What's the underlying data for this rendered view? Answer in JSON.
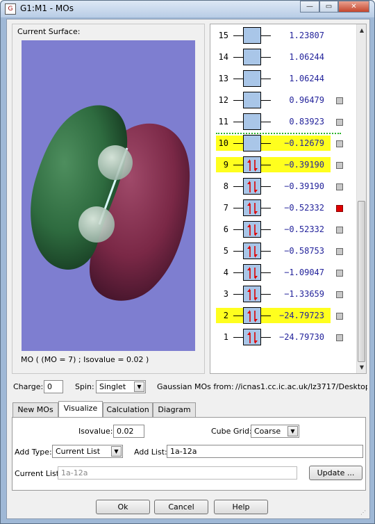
{
  "window": {
    "title": "G1:M1 - MOs",
    "icon_text": "G",
    "buttons": [
      "—",
      "▭",
      "✕"
    ]
  },
  "surface": {
    "label": "Current Surface:",
    "caption": "MO ( (MO = 7) ; Isovalue = 0.02 )"
  },
  "orbitals": [
    {
      "n": "15",
      "energy": "1.23807",
      "occ": 0,
      "highlight": false,
      "square": "none"
    },
    {
      "n": "14",
      "energy": "1.06244",
      "occ": 0,
      "highlight": false,
      "square": "none"
    },
    {
      "n": "13",
      "energy": "1.06244",
      "occ": 0,
      "highlight": false,
      "square": "none"
    },
    {
      "n": "12",
      "energy": "0.96479",
      "occ": 0,
      "highlight": false,
      "square": "grey"
    },
    {
      "n": "11",
      "energy": "0.83923",
      "occ": 0,
      "highlight": false,
      "square": "grey"
    },
    {
      "n": "10",
      "energy": "−0.12679",
      "occ": 0,
      "highlight": true,
      "square": "grey"
    },
    {
      "n": "9",
      "energy": "−0.39190",
      "occ": 2,
      "highlight": true,
      "square": "grey"
    },
    {
      "n": "8",
      "energy": "−0.39190",
      "occ": 2,
      "highlight": false,
      "square": "grey"
    },
    {
      "n": "7",
      "energy": "−0.52332",
      "occ": 2,
      "highlight": false,
      "square": "red"
    },
    {
      "n": "6",
      "energy": "−0.52332",
      "occ": 2,
      "highlight": false,
      "square": "grey"
    },
    {
      "n": "5",
      "energy": "−0.58753",
      "occ": 2,
      "highlight": false,
      "square": "grey"
    },
    {
      "n": "4",
      "energy": "−1.09047",
      "occ": 2,
      "highlight": false,
      "square": "grey"
    },
    {
      "n": "3",
      "energy": "−1.33659",
      "occ": 2,
      "highlight": false,
      "square": "grey"
    },
    {
      "n": "2",
      "energy": "−24.79723",
      "occ": 2,
      "highlight": true,
      "square": "grey"
    },
    {
      "n": "1",
      "energy": "−24.79730",
      "occ": 2,
      "highlight": false,
      "square": "grey"
    }
  ],
  "controls": {
    "charge_label": "Charge:",
    "charge_value": "0",
    "spin_label": "Spin:",
    "spin_value": "Singlet",
    "source_label": "Gaussian MOs from:",
    "source_path": "//icnas1.cc.ic.ac.uk/lz3717/Desktop"
  },
  "tabs": [
    "New MOs",
    "Visualize",
    "Calculation",
    "Diagram"
  ],
  "visualize": {
    "isovalue_label": "Isovalue:",
    "isovalue": "0.02",
    "cube_grid_label": "Cube Grid:",
    "cube_grid": "Coarse",
    "add_type_label": "Add Type:",
    "add_type": "Current List",
    "add_list_label": "Add List:",
    "add_list": "1a-12a",
    "current_list_label": "Current List:",
    "current_list": "1a-12a",
    "update_label": "Update ..."
  },
  "footer": {
    "ok": "Ok",
    "cancel": "Cancel",
    "help": "Help"
  },
  "colors": {
    "highlight": "#ffff1e",
    "positive_lobe": "#2e6b3f",
    "negative_lobe": "#7a2846",
    "viewport_bg": "#7e7ed0",
    "energy_text": "#23239b"
  }
}
